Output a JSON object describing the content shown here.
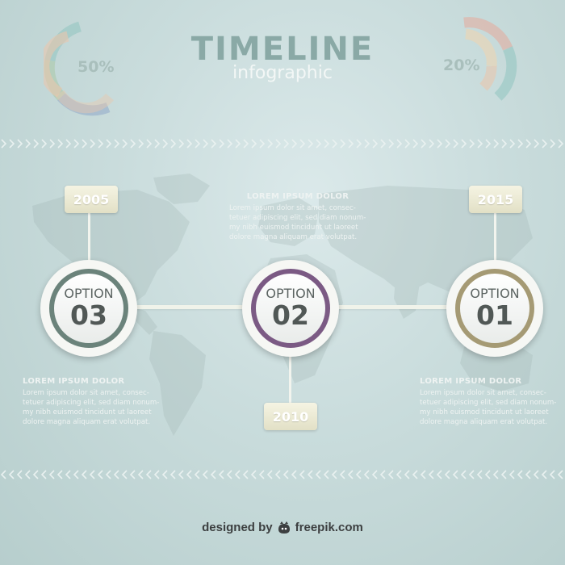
{
  "header": {
    "title": "TIMELINE",
    "subtitle": "infographic"
  },
  "rings": [
    {
      "pct_label": "50%",
      "value": 0.5
    },
    {
      "pct_label": "20%",
      "value": 0.2
    }
  ],
  "timeline": {
    "years": [
      "2005",
      "2010",
      "2015"
    ],
    "options": [
      {
        "label": "OPTION",
        "number": "03",
        "ring_color": "#6b837b"
      },
      {
        "label": "OPTION",
        "number": "02",
        "ring_color": "#7b5a84"
      },
      {
        "label": "OPTION",
        "number": "01",
        "ring_color": "#a59a74"
      }
    ]
  },
  "text_blocks": [
    {
      "heading": "LOREM IPSUM DOLOR",
      "lines": [
        "Lorem ipsum dolor sit amet, consec-",
        "tetuer adipiscing elit, sed diam nonum-",
        "my nibh euismod tincidunt ut laoreet",
        "dolore magna aliquam erat volutpat."
      ]
    },
    {
      "heading": "LOREM IPSUM DOLOR",
      "lines": [
        "Lorem ipsum dolor sit amet, consec-",
        "tetuer adipiscing elit, sed diam nonum-",
        "my nibh euismod tincidunt ut laoreet",
        "dolore magna aliquam erat volutpat."
      ]
    },
    {
      "heading": "LOREM IPSUM DOLOR",
      "lines": [
        "Lorem ipsum dolor sit amet, consec-",
        "tetuer adipiscing elit, sed diam nonum-",
        "my nibh euismod tincidunt ut laoreet",
        "dolore magna aliquam erat volutpat."
      ]
    }
  ],
  "credit": {
    "prefix": "designed by",
    "brand": "freepik.com"
  },
  "colors": {
    "ring_teal": "#8fc4c0",
    "ring_green": "#a9c9a5",
    "ring_peach": "#e9c7ad",
    "ring_blue": "#8fa7c8",
    "ring_rose": "#e6a99a",
    "ring_cream": "#e8d6b8"
  }
}
